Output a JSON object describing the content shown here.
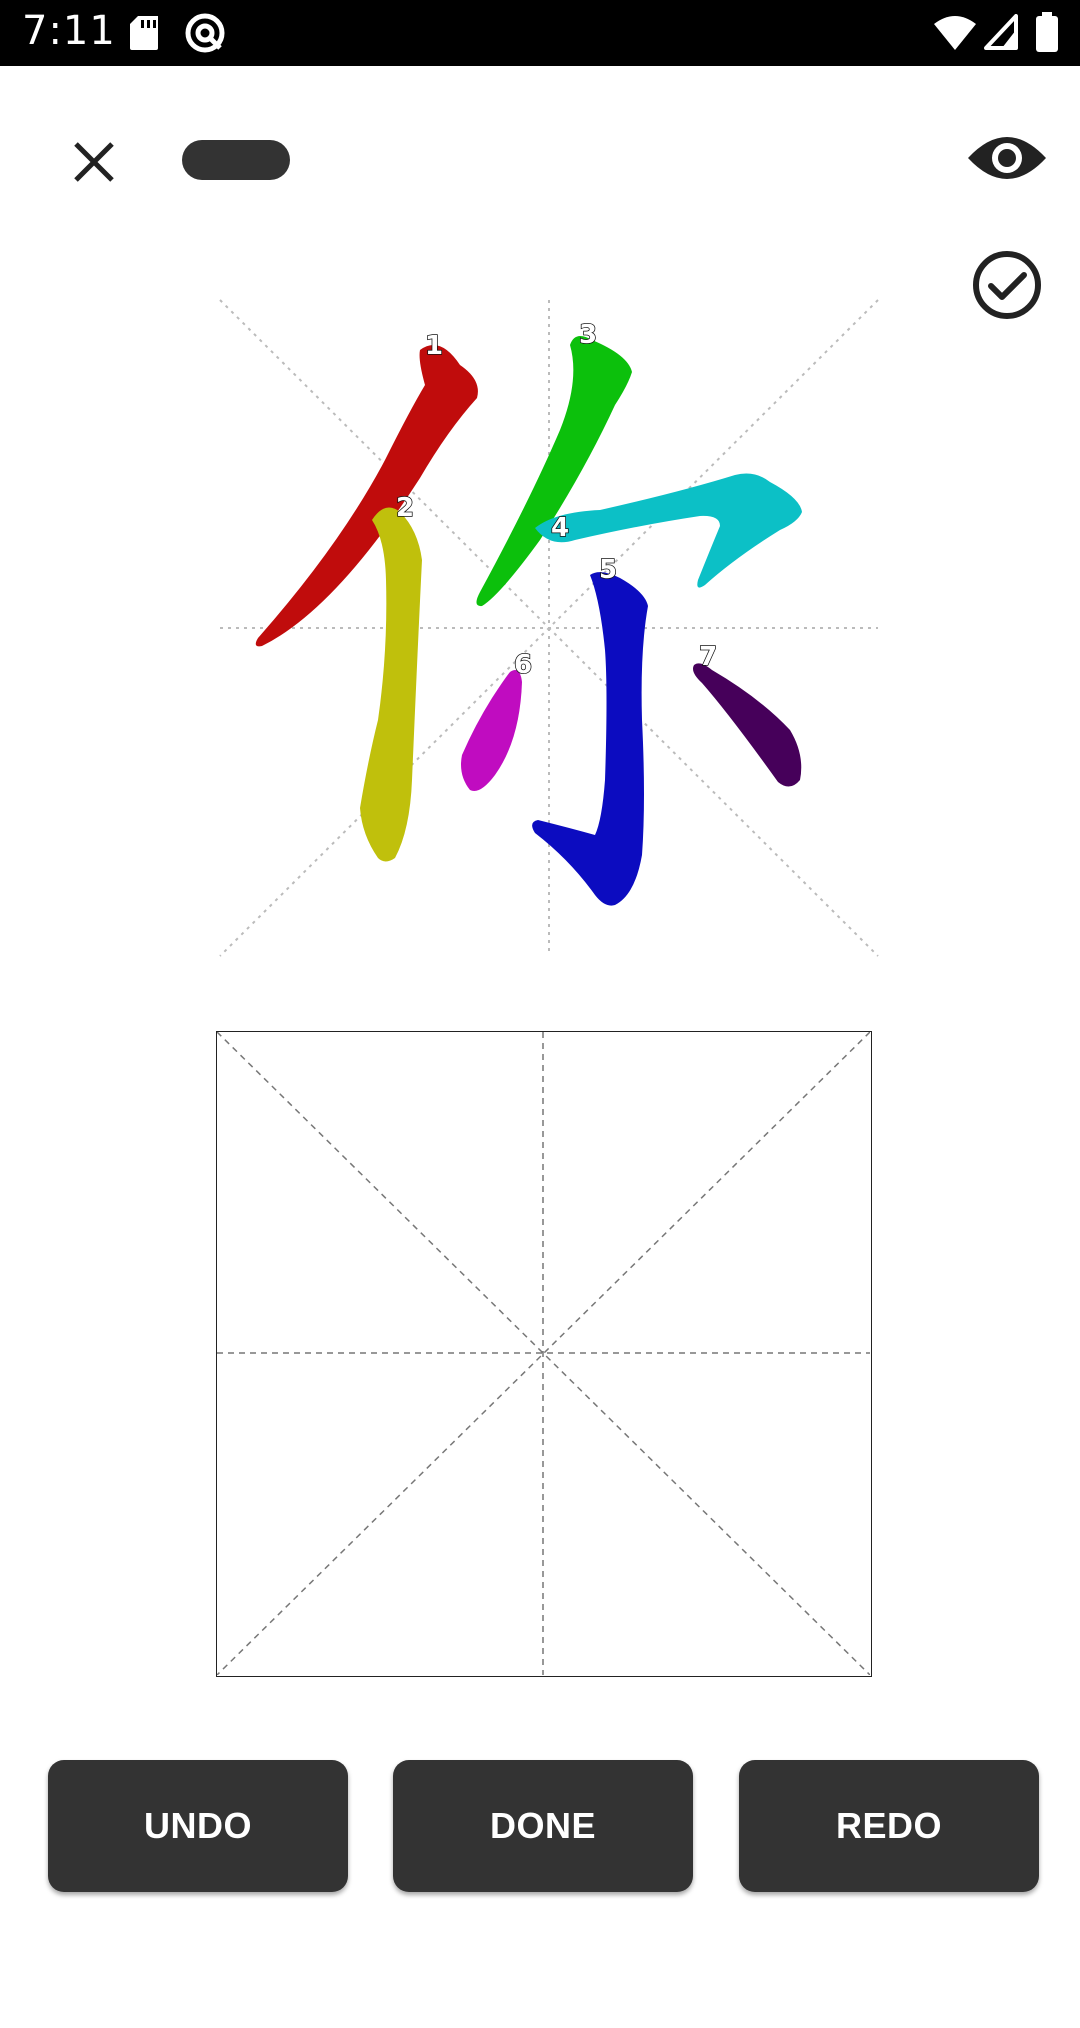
{
  "status_bar": {
    "time": "7:11",
    "icons": [
      "sd-card-icon",
      "at-sign-icon",
      "wifi-icon",
      "signal-icon",
      "battery-icon"
    ]
  },
  "toolbar": {
    "close_icon": "close-icon",
    "reveal_icon": "eye-icon",
    "check_icon": "check-circle-icon"
  },
  "character": {
    "strokes": [
      {
        "number": "1",
        "color": "#c00c0c"
      },
      {
        "number": "2",
        "color": "#c0c00c"
      },
      {
        "number": "3",
        "color": "#0cc00c"
      },
      {
        "number": "4",
        "color": "#0cc0c6"
      },
      {
        "number": "5",
        "color": "#0c0cc0"
      },
      {
        "number": "6",
        "color": "#c00cc0"
      },
      {
        "number": "7",
        "color": "#46005a"
      }
    ]
  },
  "buttons": {
    "undo_label": "UNDO",
    "done_label": "DONE",
    "redo_label": "REDO"
  },
  "colors": {
    "button_bg": "#333333",
    "status_bar_bg": "#000000"
  }
}
